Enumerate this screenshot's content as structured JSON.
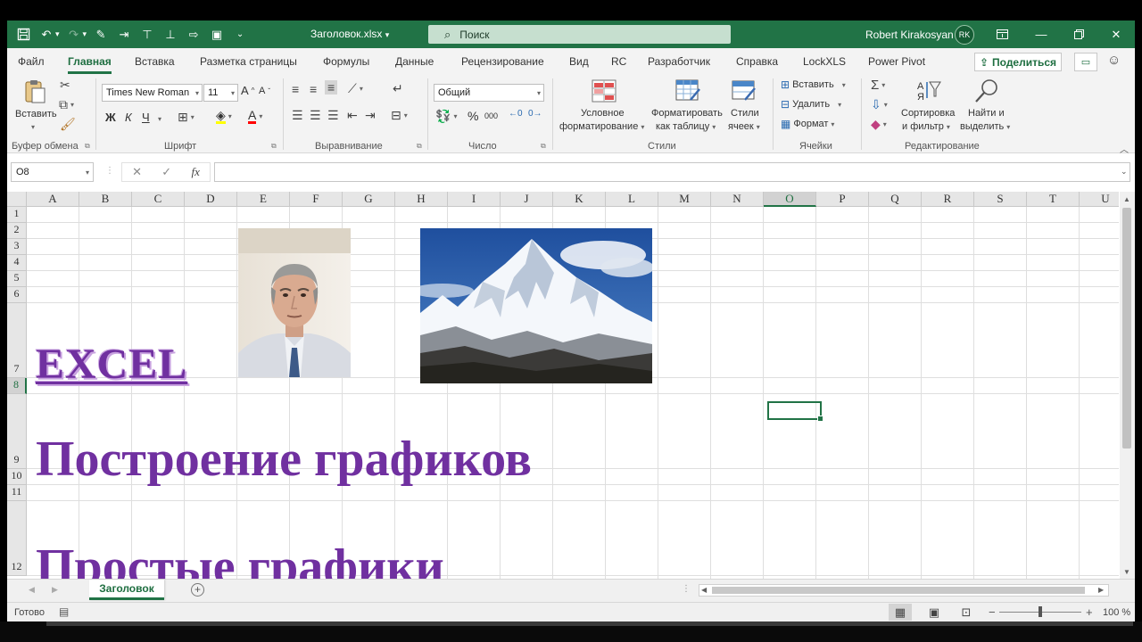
{
  "app": {
    "file_title": "Заголовок.xlsx",
    "search_placeholder": "Поиск",
    "user_name": "Robert Kirakosyan",
    "user_initials": "RK"
  },
  "menu": {
    "tabs": [
      "Файл",
      "Главная",
      "Вставка",
      "Разметка страницы",
      "Формулы",
      "Данные",
      "Рецензирование",
      "Вид",
      "RC",
      "Разработчик",
      "Справка",
      "LockXLS",
      "Power Pivot"
    ],
    "active_tab": "Главная",
    "share_label": "Поделиться"
  },
  "ribbon": {
    "clipboard": {
      "label": "Буфер обмена",
      "paste": "Вставить"
    },
    "font": {
      "label": "Шрифт",
      "font_name": "Times New Roman",
      "font_size": "11",
      "bold": "Ж",
      "italic": "К",
      "underline": "Ч"
    },
    "alignment": {
      "label": "Выравнивание"
    },
    "number": {
      "label": "Число",
      "format": "Общий",
      "percent": "%",
      "thousands": "000"
    },
    "styles": {
      "label": "Стили",
      "conditional_1": "Условное",
      "conditional_2": "форматирование",
      "format_table_1": "Форматировать",
      "format_table_2": "как таблицу",
      "cell_styles_1": "Стили",
      "cell_styles_2": "ячеек"
    },
    "cells": {
      "label": "Ячейки",
      "insert": "Вставить",
      "delete": "Удалить",
      "format": "Формат"
    },
    "editing": {
      "label": "Редактирование",
      "sort_1": "Сортировка",
      "sort_2": "и фильтр",
      "find_1": "Найти и",
      "find_2": "выделить"
    }
  },
  "formula_bar": {
    "name_box": "O8",
    "value": ""
  },
  "sheet": {
    "columns": [
      "A",
      "B",
      "C",
      "D",
      "E",
      "F",
      "G",
      "H",
      "I",
      "J",
      "K",
      "L",
      "M",
      "N",
      "O",
      "P",
      "Q",
      "R",
      "S",
      "T",
      "U"
    ],
    "rows": [
      "1",
      "2",
      "3",
      "4",
      "5",
      "6",
      "7",
      "8",
      "9",
      "10",
      "11",
      "12"
    ],
    "selected_column": "O",
    "selected_row": "8",
    "cells": {
      "A7": "EXCEL",
      "A9": "Построение графиков",
      "A12": "Простые графики"
    }
  },
  "sheet_tabs": {
    "tabs": [
      "Заголовок"
    ],
    "active": "Заголовок"
  },
  "status": {
    "ready": "Готово",
    "zoom": "100 %"
  },
  "icons": {
    "save": "save-icon",
    "undo": "undo-icon",
    "redo": "redo-icon",
    "search": "search-icon",
    "paste": "paste-icon",
    "cut": "cut-icon",
    "copy": "copy-icon",
    "format_painter": "format-painter-icon",
    "sum": "autosum-icon",
    "find": "magnifier-icon"
  },
  "colors": {
    "brand_green": "#217346",
    "title_text_purple": "#7030a0"
  }
}
